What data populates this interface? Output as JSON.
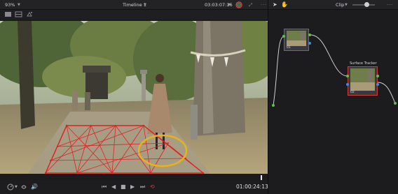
{
  "top_bar": {
    "zoom_value": "93%",
    "timeline_title": "Timeline 1",
    "timecode": "03:03:07:16",
    "node_mode": "Clip",
    "icons": [
      "chevron-down-icon",
      "color-wheel-icon",
      "fullscreen-icon",
      "more-options-icon",
      "pointer-icon",
      "hand-icon"
    ]
  },
  "sub_toolbar": {
    "icons": [
      "single-viewer-icon",
      "split-viewer-icon",
      "wipe-icon"
    ]
  },
  "viewer": {
    "content": "Japanese shrine garden with a woman walking; surface tracker mesh on ground and yellow circle highlight",
    "accent_colors": {
      "mesh": "#e02020",
      "highlight": "#e8b21a"
    }
  },
  "transport": {
    "icons": [
      "speed-menu-icon",
      "loop-menu-icon",
      "audio-icon",
      "go-to-first-frame-icon",
      "step-back-icon",
      "stop-icon",
      "play-icon",
      "step-forward-icon",
      "loop-icon"
    ],
    "timecode": "01:00:24:13"
  },
  "node_editor": {
    "nodes": [
      {
        "label": "01",
        "title": ""
      },
      {
        "label": "02",
        "title": "Surface Tracker"
      }
    ],
    "accent": "#d23a3a"
  }
}
